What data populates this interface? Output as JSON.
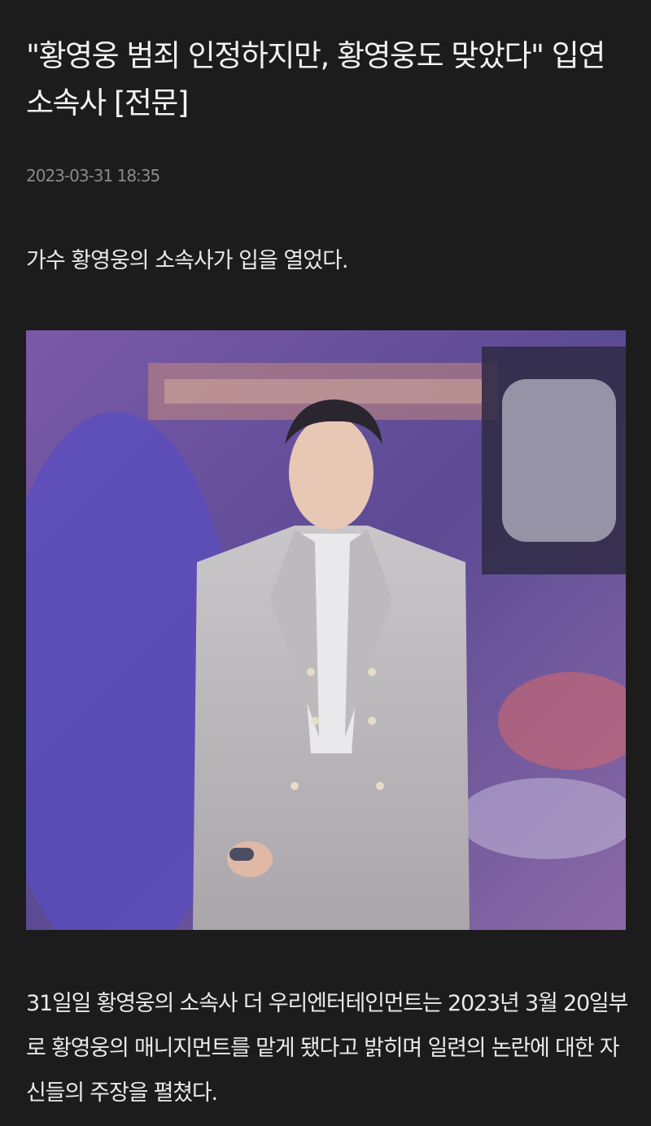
{
  "article": {
    "headline": "\"황영웅 범죄 인정하지만, 황영웅도 맞았다\" 입연 소속사 [전문]",
    "timestamp": "2023-03-31 18:35",
    "lead": "가수 황영웅의 소속사가 입을 열었다.",
    "photo": {
      "description_icon": "photo-icon"
    },
    "body": "31일일 황영웅의 소속사 더 우리엔터테인먼트는 2023년 3월 20일부로 황영웅의 매니지먼트를 맡게 됐다고 밝히며 일련의 논란에 대한 자신들의 주장을 펼쳤다."
  },
  "colors": {
    "background": "#1c1c1c",
    "text": "#ececec",
    "muted": "#8a8a8a",
    "photo_purple": "#6a56b0"
  }
}
